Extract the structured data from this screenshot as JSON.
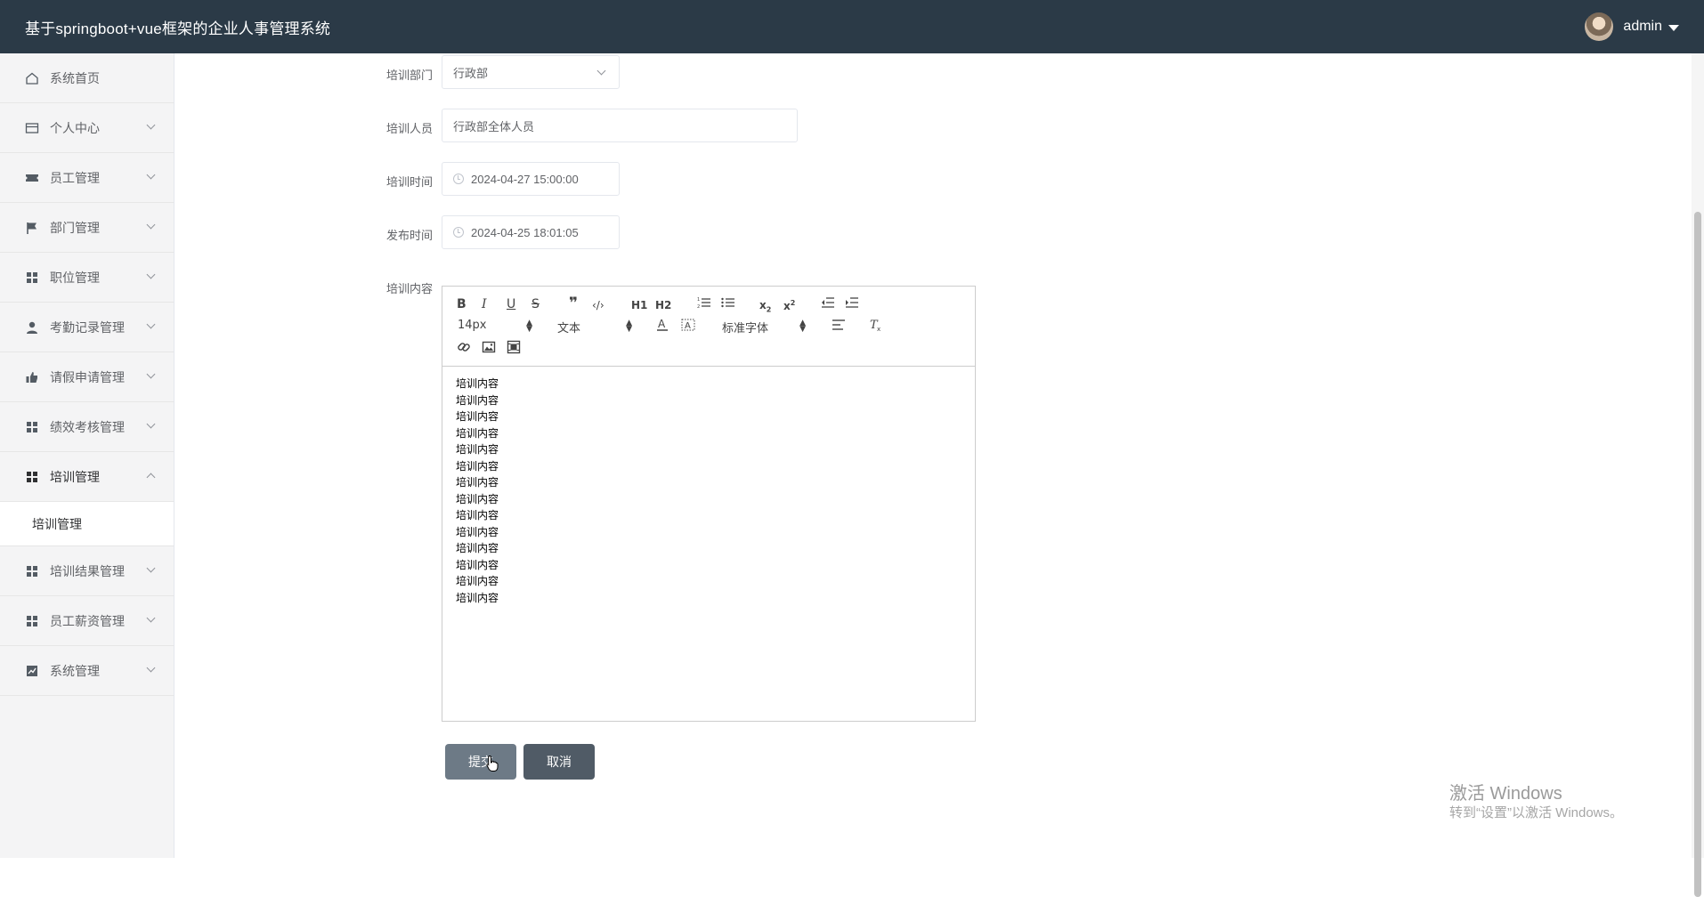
{
  "header": {
    "title": "基于springboot+vue框架的企业人事管理系统",
    "user": "admin"
  },
  "sidebar": {
    "items": [
      {
        "label": "系统首页",
        "icon": "home-icon"
      },
      {
        "label": "个人中心",
        "icon": "card-icon"
      },
      {
        "label": "员工管理",
        "icon": "ticket-icon"
      },
      {
        "label": "部门管理",
        "icon": "flag-icon"
      },
      {
        "label": "职位管理",
        "icon": "grid-icon"
      },
      {
        "label": "考勤记录管理",
        "icon": "user-icon"
      },
      {
        "label": "请假申请管理",
        "icon": "thumb-icon"
      },
      {
        "label": "绩效考核管理",
        "icon": "grid-icon"
      },
      {
        "label": "培训管理",
        "icon": "grid-icon"
      },
      {
        "label": "培训结果管理",
        "icon": "grid-icon"
      },
      {
        "label": "员工薪资管理",
        "icon": "grid-icon"
      },
      {
        "label": "系统管理",
        "icon": "chart-icon"
      }
    ],
    "submenu": {
      "label": "培训管理"
    }
  },
  "form": {
    "department": {
      "label": "培训部门",
      "value": "行政部"
    },
    "trainees": {
      "label": "培训人员",
      "value": "行政部全体人员"
    },
    "training_time": {
      "label": "培训时间",
      "value": "2024-04-27 15:00:00"
    },
    "publish_time": {
      "label": "发布时间",
      "value": "2024-04-25 18:01:05"
    },
    "content": {
      "label": "培训内容",
      "lines": [
        "培训内容",
        "培训内容",
        "培训内容",
        "培训内容",
        "培训内容",
        "培训内容",
        "培训内容",
        "培训内容",
        "培训内容",
        "培训内容",
        "培训内容",
        "培训内容",
        "培训内容",
        "培训内容"
      ]
    }
  },
  "toolbar": {
    "h1": "H1",
    "h2": "H2",
    "size": "14px",
    "text_type": "文本",
    "font": "标准字体"
  },
  "buttons": {
    "submit": "提交",
    "cancel": "取消"
  },
  "watermark": {
    "line1": "激活 Windows",
    "line2": "转到“设置”以激活 Windows。"
  }
}
